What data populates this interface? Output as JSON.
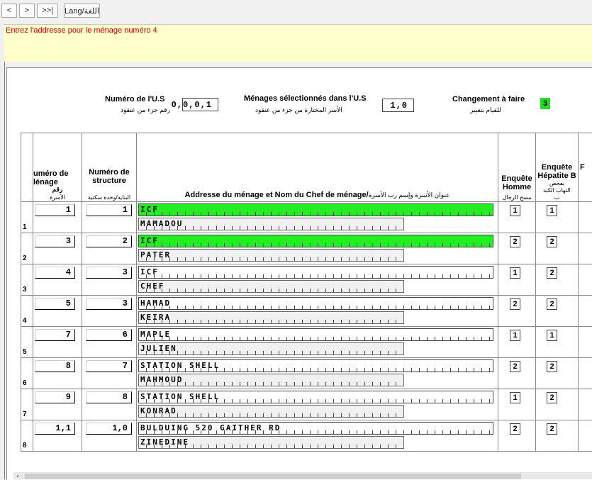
{
  "toolbar": {
    "prev": "<",
    "next": ">",
    "last": ">>|",
    "lang": "Lang/اللغة"
  },
  "message": "Entrez l'addresse pour le ménage numéro 4",
  "header": {
    "us_label": "Numéro de l'U.S",
    "us_label_ar": "رقم جزء من عنقود",
    "us_value": "0,0,0,1",
    "menages_label": "Ménages sélectionnés dans l'U.S",
    "menages_label_ar": "الأسر المختارة من جزء من عنقود",
    "menages_value": "1,0",
    "change_label": "Changement à faire",
    "change_label_ar": "للقيام بتغيير",
    "change_value": "3"
  },
  "columns": {
    "menage": "uméro de lénage",
    "menage_ar1": "رقم",
    "menage_ar2": "الأسرة",
    "structure": "Numéro de structure",
    "structure_ar": "البناية/وحدة سكنية",
    "address": "Addresse du ménage et Nom du Chef de ménage/",
    "address_ar_inline": "عنوان الأسرة وإسم رب الأسرة",
    "address_ar": "عنوان الأسرة وإسم رب الأسرة",
    "homme": "Enquête Homme",
    "homme_ar": "مسح الرجال",
    "hep": "Enquête Hépatite B",
    "hep_ar1": "بفحص",
    "hep_ar2": "التهاب الكبد",
    "hep_ar3": "ب",
    "extra": "F"
  },
  "rows": [
    {
      "num": "1",
      "menage": "1",
      "structure": "1",
      "address": "ICF",
      "address_green": true,
      "name": "MAMADOU",
      "homme": "1",
      "hep": "1"
    },
    {
      "num": "2",
      "menage": "3",
      "structure": "2",
      "address": "ICF",
      "address_green": true,
      "name": "PATER",
      "homme": "2",
      "hep": "2"
    },
    {
      "num": "3",
      "menage": "4",
      "structure": "3",
      "address": "ICF",
      "address_green": false,
      "name": "CHEF",
      "homme": "1",
      "hep": "2"
    },
    {
      "num": "4",
      "menage": "5",
      "structure": "3",
      "address": "HAMAD",
      "address_green": false,
      "name": "KEIRA",
      "homme": "2",
      "hep": "2"
    },
    {
      "num": "5",
      "menage": "7",
      "structure": "6",
      "address": "MAPLE",
      "address_green": false,
      "name": "JULIEN",
      "homme": "1",
      "hep": "1"
    },
    {
      "num": "6",
      "menage": "8",
      "structure": "7",
      "address": "STATION SHELL",
      "address_green": false,
      "name": "MAHMOUD",
      "homme": "2",
      "hep": "2"
    },
    {
      "num": "7",
      "menage": "9",
      "structure": "8",
      "address": "STATION SHELL",
      "address_green": false,
      "name": "KONRAD",
      "homme": "1",
      "hep": "2"
    },
    {
      "num": "8",
      "menage": "1,1",
      "structure": "1,0",
      "address": "BULDUING 520 GAITHER RD",
      "address_green": false,
      "name": "ZINEDINE",
      "homme": "2",
      "hep": "2"
    }
  ]
}
